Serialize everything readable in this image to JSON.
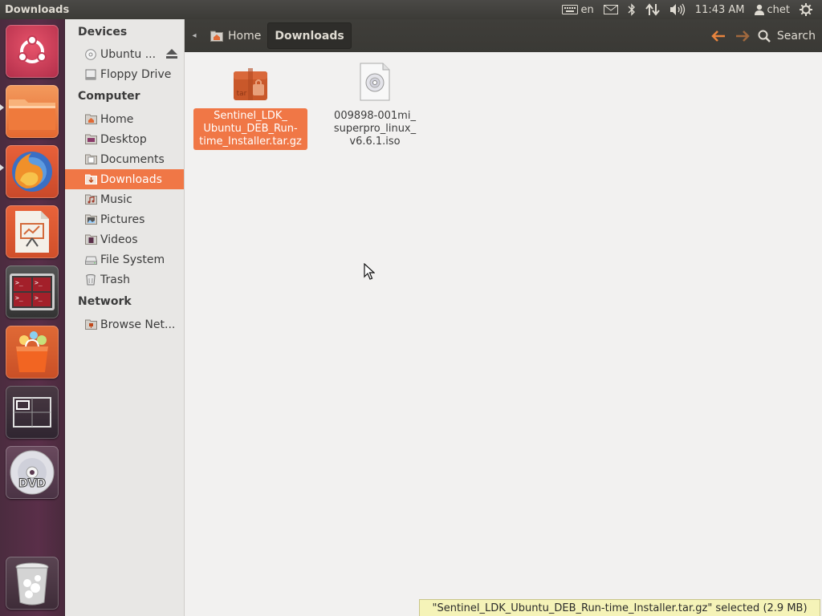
{
  "panel": {
    "window_title": "Downloads",
    "keyboard_layout": "en",
    "clock": "11:43 AM",
    "user": "chet"
  },
  "launcher": {
    "items": [
      {
        "name": "Dash home",
        "icon": "ubuntu-logo-icon"
      },
      {
        "name": "Files",
        "icon": "folder-icon"
      },
      {
        "name": "Firefox",
        "icon": "firefox-icon"
      },
      {
        "name": "LibreOffice Impress",
        "icon": "presentation-icon"
      },
      {
        "name": "Workspaces",
        "icon": "terminal-grid-icon"
      },
      {
        "name": "Ubuntu Software Center",
        "icon": "shopping-bag-icon"
      },
      {
        "name": "Workspace switcher",
        "icon": "workspace-icon"
      },
      {
        "name": "DVD",
        "icon": "dvd-icon"
      },
      {
        "name": "Trash",
        "icon": "trash-icon"
      }
    ]
  },
  "toolbar": {
    "breadcrumbs": [
      {
        "label": "Home",
        "icon": "home-folder-icon"
      },
      {
        "label": "Downloads",
        "active": true
      }
    ],
    "search_label": "Search"
  },
  "sidebar": {
    "sections": [
      {
        "header": "Devices",
        "items": [
          {
            "label": "Ubuntu ...",
            "icon": "disc-icon"
          },
          {
            "label": "Floppy Drive",
            "icon": "floppy-icon"
          }
        ]
      },
      {
        "header": "Computer",
        "items": [
          {
            "label": "Home",
            "icon": "home-folder-icon"
          },
          {
            "label": "Desktop",
            "icon": "desktop-folder-icon"
          },
          {
            "label": "Documents",
            "icon": "documents-folder-icon"
          },
          {
            "label": "Downloads",
            "icon": "downloads-folder-icon",
            "selected": true
          },
          {
            "label": "Music",
            "icon": "music-folder-icon"
          },
          {
            "label": "Pictures",
            "icon": "pictures-folder-icon"
          },
          {
            "label": "Videos",
            "icon": "videos-folder-icon"
          },
          {
            "label": "File System",
            "icon": "harddisk-icon"
          },
          {
            "label": "Trash",
            "icon": "trash-icon"
          }
        ]
      },
      {
        "header": "Network",
        "items": [
          {
            "label": "Browse Net...",
            "icon": "network-folder-icon"
          }
        ]
      }
    ]
  },
  "files": [
    {
      "name": "Sentinel_LDK_\nUbuntu_DEB_Run-\ntime_Installer.tar.gz",
      "icon": "tar-archive-icon",
      "icon_text": "tar",
      "selected": true
    },
    {
      "name": "009898-001mi_\nsuperpro_linux_\nv6.6.1.iso",
      "icon": "disc-image-icon",
      "selected": false
    }
  ],
  "status": {
    "text": "\"Sentinel_LDK_Ubuntu_DEB_Run-time_Installer.tar.gz\" selected (2.9 MB)"
  },
  "colors": {
    "accent": "#f07746",
    "panel": "#3c3b37",
    "launcher": "#5a2f49"
  }
}
